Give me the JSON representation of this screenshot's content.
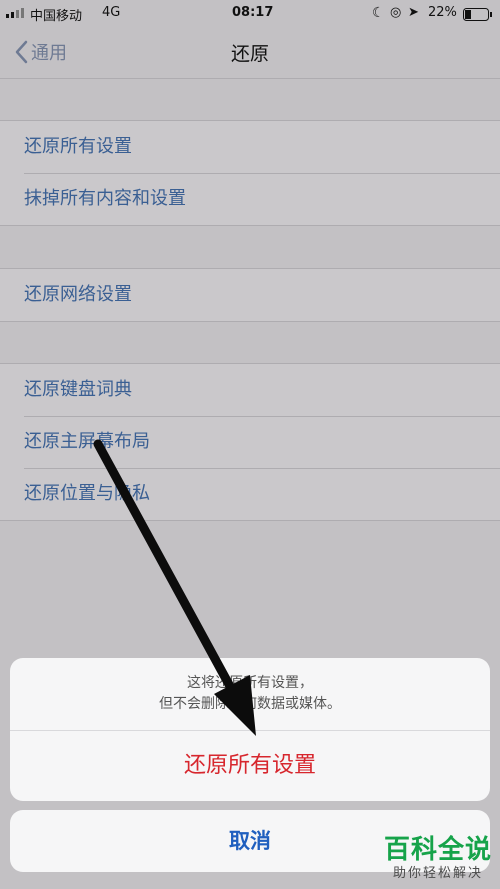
{
  "status": {
    "carrier": "中国移动",
    "network": "4G",
    "time": "08:17",
    "battery": "22%"
  },
  "nav": {
    "back_label": "通用",
    "title": "还原"
  },
  "groups": [
    {
      "items": [
        {
          "label": "还原所有设置"
        },
        {
          "label": "抹掉所有内容和设置"
        }
      ]
    },
    {
      "items": [
        {
          "label": "还原网络设置"
        }
      ]
    },
    {
      "items": [
        {
          "label": "还原键盘词典"
        },
        {
          "label": "还原主屏幕布局"
        },
        {
          "label": "还原位置与隐私"
        }
      ]
    }
  ],
  "action_sheet": {
    "message_line1": "这将还原所有设置，",
    "message_line2": "但不会删除任何数据或媒体。",
    "destructive_label": "还原所有设置",
    "cancel_label": "取消"
  },
  "watermark": {
    "title": "百科全说",
    "subtitle": "助你轻松解决"
  },
  "colors": {
    "accent": "#3a5f93",
    "destructive": "#d7262d",
    "cancel": "#1f5fbf",
    "watermark": "#16a34a"
  }
}
